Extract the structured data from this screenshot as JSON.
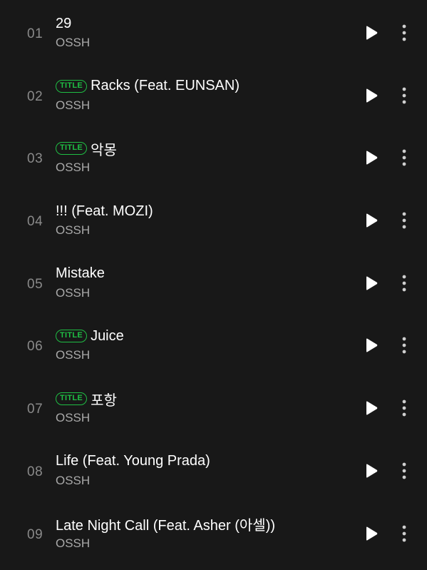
{
  "accent_color": "#1fbf44",
  "badge_label": "TITLE",
  "tracks": [
    {
      "number": "01",
      "title": "29",
      "artist": "OSSH",
      "is_title": false
    },
    {
      "number": "02",
      "title": "Racks (Feat. EUNSAN)",
      "artist": "OSSH",
      "is_title": true
    },
    {
      "number": "03",
      "title": "악몽",
      "artist": "OSSH",
      "is_title": true
    },
    {
      "number": "04",
      "title": "!!! (Feat. MOZI)",
      "artist": "OSSH",
      "is_title": false
    },
    {
      "number": "05",
      "title": "Mistake",
      "artist": "OSSH",
      "is_title": false
    },
    {
      "number": "06",
      "title": "Juice",
      "artist": "OSSH",
      "is_title": true
    },
    {
      "number": "07",
      "title": "포항",
      "artist": "OSSH",
      "is_title": true
    },
    {
      "number": "08",
      "title": "Life (Feat. Young Prada)",
      "artist": "OSSH",
      "is_title": false
    },
    {
      "number": "09",
      "title": "Late Night Call (Feat. Asher (아셀))",
      "artist": "OSSH",
      "is_title": false
    }
  ],
  "icons": {
    "play": "play-icon",
    "more": "more-vertical-icon"
  }
}
